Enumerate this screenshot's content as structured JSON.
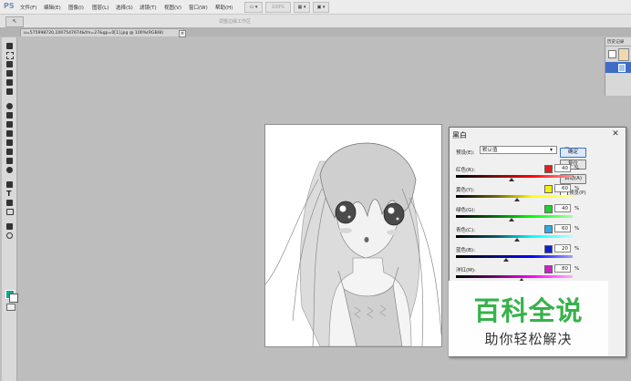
{
  "app": {
    "logo": "PS"
  },
  "menubar": {
    "items": [
      "文件(F)",
      "编辑(E)",
      "图像(I)",
      "图层(L)",
      "选择(S)",
      "滤镜(T)",
      "视图(V)",
      "窗口(W)",
      "帮助(H)"
    ],
    "zoom": "100%"
  },
  "options_bar": {
    "tool_glyph": "↖",
    "hint": "调整边缘工作区"
  },
  "document": {
    "tab_title": "u=575998720,1007547674&fm=27&gp=0[1].jpg @ 100%(RGB/8)",
    "tab_close": "×"
  },
  "history_panel": {
    "title": "历史记录"
  },
  "dialog": {
    "title": "黑白",
    "close": "✕",
    "preset_label": "预设(E):",
    "preset_value": "默认值",
    "ok_label": "确定",
    "reset_label": "复位",
    "auto_label": "自动(A)",
    "preview_label": "预览(P)",
    "preview_checked": "✓",
    "channels": [
      {
        "label": "红色(R):",
        "value": "40",
        "unit": "%",
        "color": "#e02020",
        "slider_pos": 0.475,
        "gradient": "linear-gradient(90deg,#000 0%,#7a1010 35%,#ff0000 65%,#ff9a9a 100%)"
      },
      {
        "label": "黄色(Y):",
        "value": "60",
        "unit": "%",
        "color": "#f4f000",
        "slider_pos": 0.52,
        "gradient": "linear-gradient(90deg,#000 0%,#6e6a00 35%,#ffff00 65%,#ffffa0 100%)"
      },
      {
        "label": "绿色(G):",
        "value": "40",
        "unit": "%",
        "color": "#20d030",
        "slider_pos": 0.475,
        "gradient": "linear-gradient(90deg,#000 0%,#0d6e10 35%,#00ff00 65%,#a8ffa8 100%)"
      },
      {
        "label": "青色(C):",
        "value": "60",
        "unit": "%",
        "color": "#30a8e8",
        "slider_pos": 0.52,
        "gradient": "linear-gradient(90deg,#000 0%,#0a5a6e 35%,#00ffff 65%,#b8ffff 100%)"
      },
      {
        "label": "蓝色(B):",
        "value": "20",
        "unit": "%",
        "color": "#1020c8",
        "slider_pos": 0.43,
        "gradient": "linear-gradient(90deg,#000 0%,#0a0a7a 35%,#0000ff 65%,#a0a0ff 100%)"
      },
      {
        "label": "洋红(M):",
        "value": "80",
        "unit": "%",
        "color": "#d020c8",
        "slider_pos": 0.565,
        "gradient": "linear-gradient(90deg,#000 0%,#6e0a6a 35%,#ff00ff 65%,#ffb0ff 100%)"
      }
    ]
  },
  "watermark": {
    "title": "百科全说",
    "subtitle": "助你轻松解决"
  },
  "colors": {
    "foreground": "#1aa38a",
    "background": "#ffffff",
    "ok_highlight": "#3f6fc1"
  }
}
